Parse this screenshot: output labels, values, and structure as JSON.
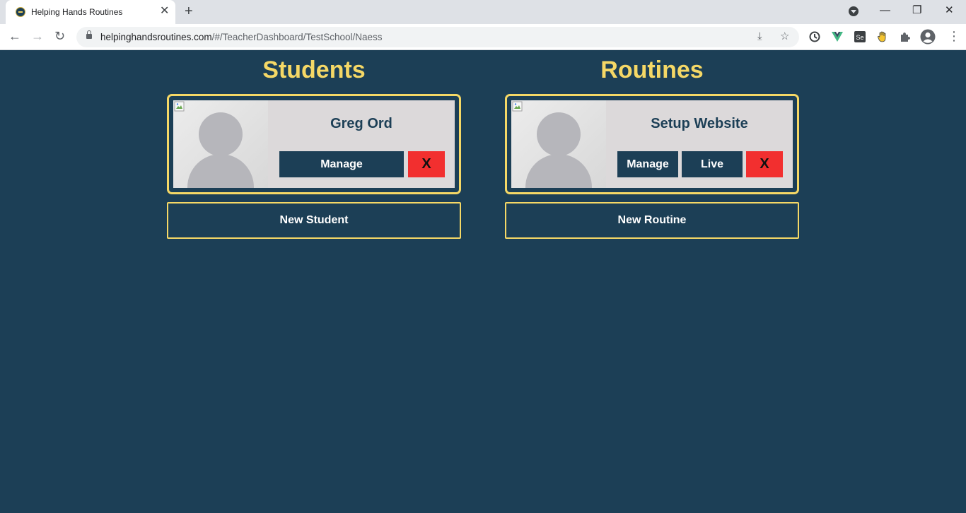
{
  "browser": {
    "tab_title": "Helping Hands Routines",
    "url_host": "helpinghandsroutines.com",
    "url_path": "/#/TeacherDashboard/TestSchool/Naess"
  },
  "icons": {
    "favicon": "helping-hands-favicon",
    "back": "arrow-left-icon",
    "forward": "arrow-right-icon",
    "reload": "reload-icon",
    "lock": "lock-icon",
    "install": "install-icon",
    "bookmark": "star-icon",
    "extensions": "puzzle-icon",
    "profile": "profile-icon",
    "menu": "kebab-menu-icon"
  },
  "students": {
    "heading": "Students",
    "items": [
      {
        "name": "Greg Ord",
        "manage_label": "Manage",
        "delete_label": "X"
      }
    ],
    "new_label": "New Student"
  },
  "routines": {
    "heading": "Routines",
    "items": [
      {
        "name": "Setup Website",
        "manage_label": "Manage",
        "live_label": "Live",
        "delete_label": "X"
      }
    ],
    "new_label": "New Routine"
  },
  "colors": {
    "background": "#1c3f56",
    "accent_yellow": "#f5d866",
    "delete_red": "#f22f2f",
    "card_bg": "#dcd9da"
  }
}
